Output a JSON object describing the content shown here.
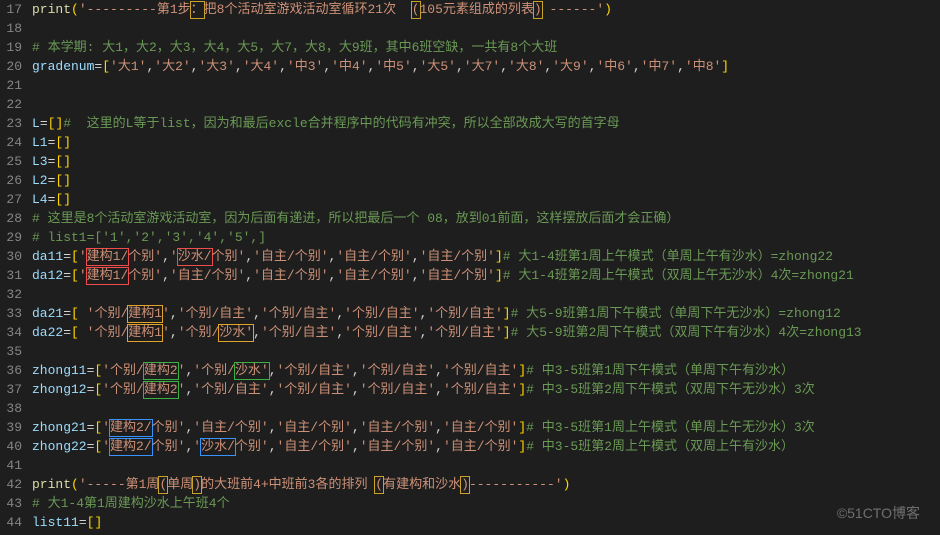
{
  "watermark": "©51CTO博客",
  "lines": [
    {
      "n": 17,
      "html": "<span class='c-fn'>print</span><span class='c-gold'>(</span><span class='c-str'>'---------第1步<span class='box b-gold'>：</span>把8个活动室游戏活动室循环21次  <span class='box b-gold'>(</span>105元素组成的列表<span class='box b-gold'>)</span> ------'</span><span class='c-gold'>)</span>"
    },
    {
      "n": 18,
      "html": ""
    },
    {
      "n": 19,
      "html": "<span class='c-com'># 本学期: 大1，大2，大3，大4，大5，大7，大8，大9班，其中6班空缺，一共有8个大班</span>"
    },
    {
      "n": 20,
      "html": "<span class='c-var'>gradenum</span><span class='c-brk'>=</span><span class='c-gold'>[</span><span class='c-str'>'大1'</span>,<span class='c-str'>'大2'</span>,<span class='c-str'>'大3'</span>,<span class='c-str'>'大4'</span>,<span class='c-str'>'中3'</span>,<span class='c-str'>'中4'</span>,<span class='c-str'>'中5'</span>,<span class='c-str'>'大5'</span>,<span class='c-str'>'大7'</span>,<span class='c-str'>'大8'</span>,<span class='c-str'>'大9'</span>,<span class='c-str'>'中6'</span>,<span class='c-str'>'中7'</span>,<span class='c-str'>'中8'</span><span class='c-gold'>]</span>"
    },
    {
      "n": 21,
      "html": ""
    },
    {
      "n": 22,
      "html": ""
    },
    {
      "n": 23,
      "html": "<span class='c-var'>L</span><span class='c-brk'>=</span><span class='c-gold'>[</span><span class='c-gold'>]</span><span class='c-com'>#  这里的L等于list，因为和最后excle合并程序中的代码有冲突，所以全部改成大写的首字母</span>"
    },
    {
      "n": 24,
      "html": "<span class='c-var'>L1</span><span class='c-brk'>=</span><span class='c-gold'>[</span><span class='c-gold'>]</span>"
    },
    {
      "n": 25,
      "html": "<span class='c-var'>L3</span><span class='c-brk'>=</span><span class='c-gold'>[</span><span class='c-gold'>]</span>"
    },
    {
      "n": 26,
      "html": "<span class='c-var'>L2</span><span class='c-brk'>=</span><span class='c-gold'>[</span><span class='c-gold'>]</span>"
    },
    {
      "n": 27,
      "html": "<span class='c-var'>L4</span><span class='c-brk'>=</span><span class='c-gold'>[</span><span class='c-gold'>]</span>"
    },
    {
      "n": 28,
      "html": "<span class='c-com'># 这里是8个活动室游戏活动室，因为后面有递进，所以把最后一个 08，放到01前面，这样摆放后面才会正确）</span>"
    },
    {
      "n": 29,
      "html": "<span class='c-com'># list1=['1','2','3','4','5',]</span>"
    },
    {
      "n": 30,
      "html": "<span class='c-var'>da11</span><span class='c-brk'>=</span><span class='c-gold'>[</span><span class='c-str'>'<span class='box b-red'>建构1/</span>个别'</span>,<span class='c-str'>'<span class='box b-red'>沙水/</span>个别'</span>,<span class='c-str'>'自主/个别'</span>,<span class='c-str'>'自主/个别'</span>,<span class='c-str'>'自主/个别'</span><span class='c-gold'>]</span><span class='c-com'># 大1-4班第1周上午模式（单周上午有沙水）=zhong22</span>"
    },
    {
      "n": 31,
      "html": "<span class='c-var'>da12</span><span class='c-brk'>=</span><span class='c-gold'>[</span><span class='c-str'>'<span class='box b-red'>建构1/</span>个别'</span>,<span class='c-str'>'自主/个别'</span>,<span class='c-str'>'自主/个别'</span>,<span class='c-str'>'自主/个别'</span>,<span class='c-str'>'自主/个别'</span><span class='c-gold'>]</span><span class='c-com'># 大1-4班第2周上午模式（双周上午无沙水）4次=zhong21</span>"
    },
    {
      "n": 32,
      "html": ""
    },
    {
      "n": 33,
      "html": "<span class='c-var'>da21</span><span class='c-brk'>=</span><span class='c-gold'>[</span> <span class='c-str'>'个别/<span class='box b-orange'>建构1</span>'</span>,<span class='c-str'>'个别/自主'</span>,<span class='c-str'>'个别/自主'</span>,<span class='c-str'>'个别/自主'</span>,<span class='c-str'>'个别/自主'</span><span class='c-gold'>]</span><span class='c-com'># 大5-9班第1周下午模式（单周下午无沙水）=zhong12</span>"
    },
    {
      "n": 34,
      "html": "<span class='c-var'>da22</span><span class='c-brk'>=</span><span class='c-gold'>[</span> <span class='c-str'>'个别/<span class='box b-orange'>建构1</span>'</span>,<span class='c-str'>'个别/<span class='box b-orange'>沙水'</span></span>,<span class='c-str'>'个别/自主'</span>,<span class='c-str'>'个别/自主'</span>,<span class='c-str'>'个别/自主'</span><span class='c-gold'>]</span><span class='c-com'># 大5-9班第2周下午模式（双周下午有沙水）4次=zhong13</span>"
    },
    {
      "n": 35,
      "html": ""
    },
    {
      "n": 36,
      "html": "<span class='c-var'>zhong11</span><span class='c-brk'>=</span><span class='c-gold'>[</span><span class='c-str'>'个别/<span class='box b-green'>建构2</span>'</span>,<span class='c-str'>'个别/<span class='box b-green'>沙水'</span></span>,<span class='c-str'>'个别/自主'</span>,<span class='c-str'>'个别/自主'</span>,<span class='c-str'>'个别/自主'</span><span class='c-gold'>]</span><span class='c-com'># 中3-5班第1周下午模式（单周下午有沙水）</span>"
    },
    {
      "n": 37,
      "html": "<span class='c-var'>zhong12</span><span class='c-brk'>=</span><span class='c-gold'>[</span><span class='c-str'>'个别/<span class='box b-green'>建构2</span>'</span>,<span class='c-str'>'个别/自主'</span>,<span class='c-str'>'个别/自主'</span>,<span class='c-str'>'个别/自主'</span>,<span class='c-str'>'个别/自主'</span><span class='c-gold'>]</span><span class='c-com'># 中3-5班第2周下午模式（双周下午无沙水）3次</span>"
    },
    {
      "n": 38,
      "html": ""
    },
    {
      "n": 39,
      "html": "<span class='c-var'>zhong21</span><span class='c-brk'>=</span><span class='c-gold'>[</span><span class='c-str'>'<span class='box b-blue'>建构2/</span>个别'</span>,<span class='c-str'>'自主/个别'</span>,<span class='c-str'>'自主/个别'</span>,<span class='c-str'>'自主/个别'</span>,<span class='c-str'>'自主/个别'</span><span class='c-gold'>]</span><span class='c-com'># 中3-5班第1周上午模式（单周上午无沙水）3次</span>"
    },
    {
      "n": 40,
      "html": "<span class='c-var'>zhong22</span><span class='c-brk'>=</span><span class='c-gold'>[</span><span class='c-str'>'<span class='box b-blue'>建构2/</span>个别'</span>,<span class='c-str'>'<span class='box b-blue'>沙水/</span>个别'</span>,<span class='c-str'>'自主/个别'</span>,<span class='c-str'>'自主/个别'</span>,<span class='c-str'>'自主/个别'</span><span class='c-gold'>]</span><span class='c-com'># 中3-5班第2周上午模式（双周上午有沙水）</span>"
    },
    {
      "n": 41,
      "html": ""
    },
    {
      "n": 42,
      "html": "<span class='c-fn'>print</span><span class='c-gold'>(</span><span class='c-str'>'-----第1周<span class='box b-gold'>(</span>单周<span class='box b-gold'>)</span>的大班前4+中班前3各的排列 <span class='box b-gold'>(</span>有建构和沙水<span class='box b-gold'>)</span>-----------'</span><span class='c-gold'>)</span>"
    },
    {
      "n": 43,
      "html": "<span class='c-com'># 大1-4第1周建构沙水上午班4个</span>"
    },
    {
      "n": 44,
      "html": "<span class='c-var'>list11</span><span class='c-brk'>=</span><span class='c-gold'>[</span><span class='c-gold'>]</span>"
    }
  ]
}
